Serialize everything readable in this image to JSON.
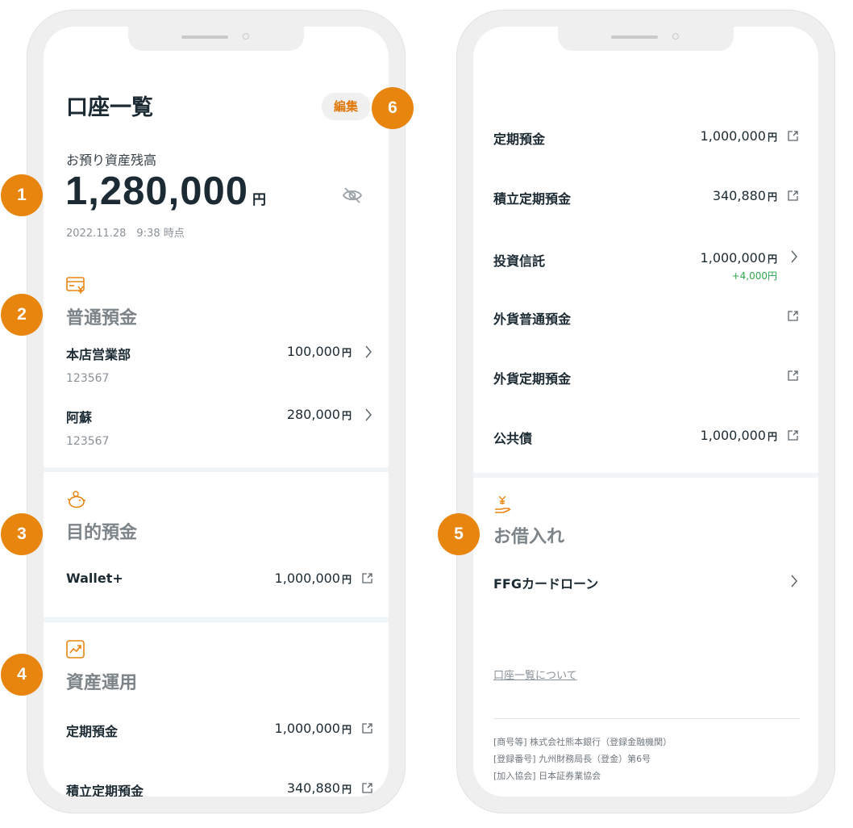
{
  "colors": {
    "accent": "#e8850f",
    "accent_text": "#e0780a",
    "gain": "#2fa84f",
    "text": "#1c2a33",
    "muted": "#8a9299"
  },
  "header": {
    "title": "口座一覧",
    "edit_label": "編集"
  },
  "badges": [
    "1",
    "2",
    "3",
    "4",
    "5",
    "6"
  ],
  "balance": {
    "label": "お預り資産残高",
    "amount": "1,280,000",
    "unit": "円",
    "as_of": "2022.11.28　9:38 時点"
  },
  "savings": {
    "icon": "card-yen-icon",
    "title": "普通預金",
    "items": [
      {
        "name": "本店営業部",
        "number": "123567",
        "amount": "100,000",
        "unit": "円"
      },
      {
        "name": "阿蘇",
        "number": "123567",
        "amount": "280,000",
        "unit": "円"
      }
    ]
  },
  "goal": {
    "icon": "piggy-bank-icon",
    "title": "目的預金",
    "items": [
      {
        "name": "Wallet+",
        "amount": "1,000,000",
        "unit": "円"
      }
    ]
  },
  "assets": {
    "icon": "chart-icon",
    "title": "資産運用",
    "items_left": [
      {
        "name": "定期預金",
        "amount": "1,000,000",
        "unit": "円"
      },
      {
        "name": "積立定期預金",
        "amount": "340,880",
        "unit": "円"
      }
    ],
    "items": [
      {
        "name": "定期預金",
        "amount": "1,000,000",
        "unit": "円"
      },
      {
        "name": "積立定期預金",
        "amount": "340,880",
        "unit": "円"
      },
      {
        "name": "投資信託",
        "amount": "1,000,000",
        "unit": "円",
        "gain": "+4,000",
        "gain_unit": "円"
      },
      {
        "name": "外貨普通預金"
      },
      {
        "name": "外貨定期預金"
      },
      {
        "name": "公共債",
        "amount": "1,000,000",
        "unit": "円"
      }
    ]
  },
  "loans": {
    "icon": "hand-yen-icon",
    "title": "お借入れ",
    "items": [
      {
        "name": "FFGカードローン"
      }
    ]
  },
  "footer": {
    "about_link": "口座一覧について",
    "lines": [
      "[商号等] 株式会社熊本銀行（登録金融機関）",
      "[登録番号] 九州財務局長（登金）第6号",
      "[加入協会] 日本証券業協会"
    ]
  }
}
